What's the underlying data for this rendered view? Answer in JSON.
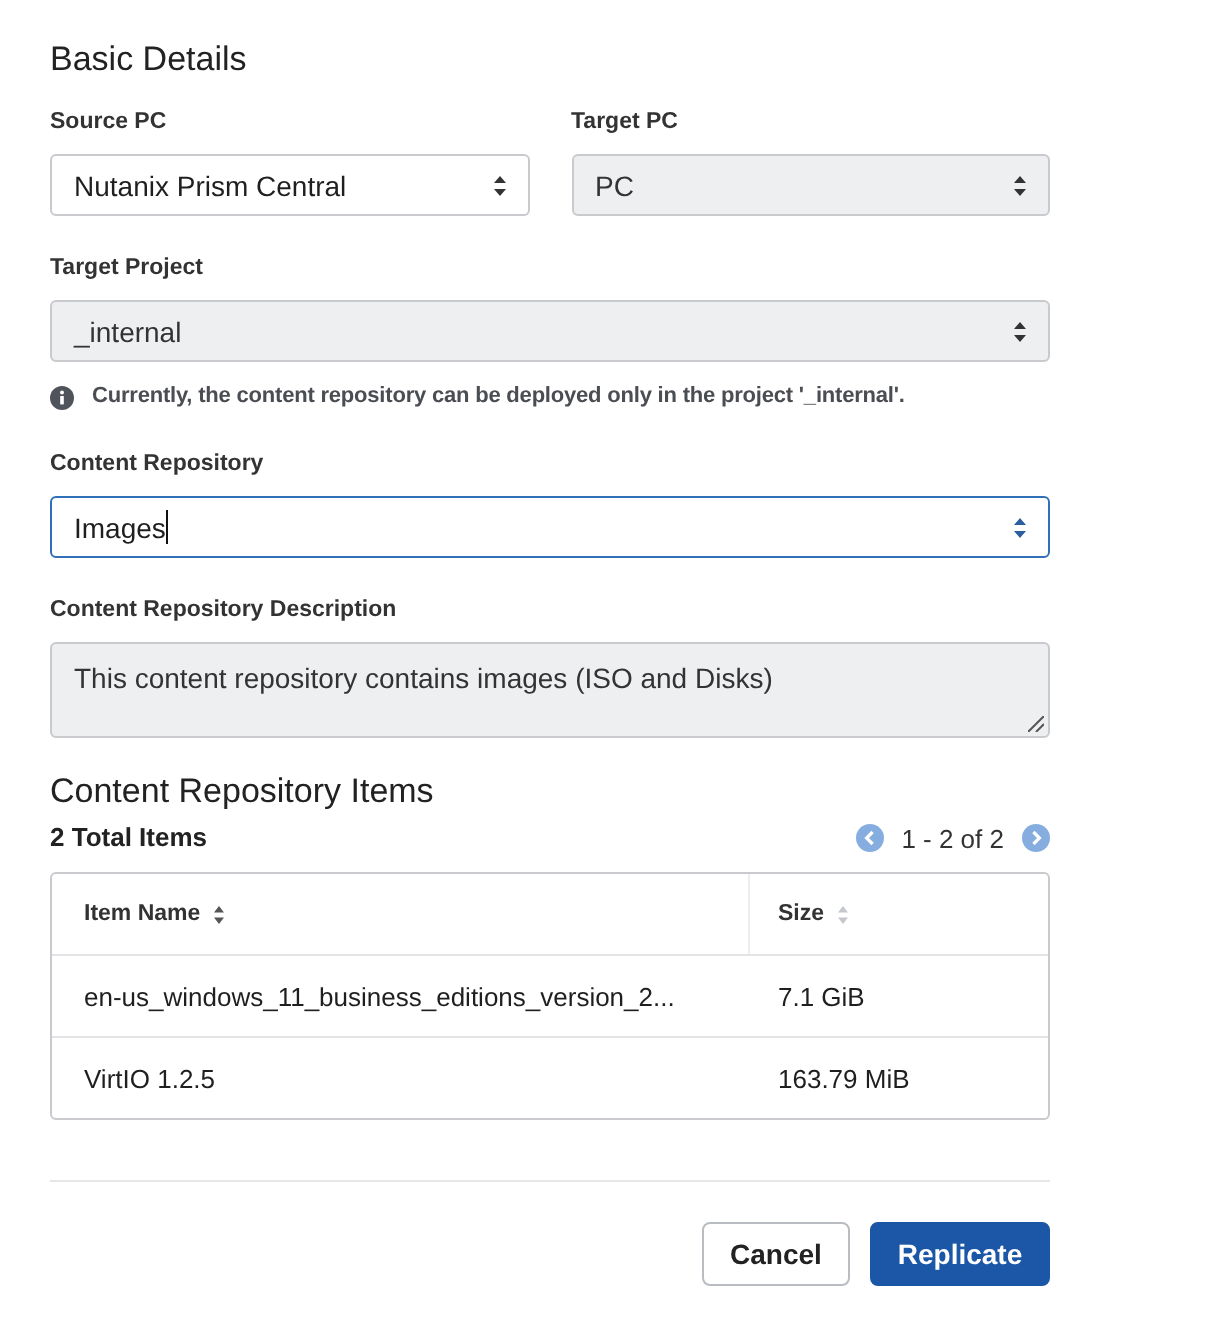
{
  "heading": "Basic Details",
  "source_pc": {
    "label": "Source PC",
    "value": "Nutanix Prism Central",
    "disabled": false,
    "focused": false
  },
  "target_pc": {
    "label": "Target PC",
    "value": "PC",
    "disabled": true,
    "focused": false
  },
  "target_project": {
    "label": "Target Project",
    "value": "_internal",
    "disabled": true,
    "focused": false,
    "note": "Currently, the content repository can be deployed only in the project '_internal'."
  },
  "content_repository": {
    "label": "Content Repository",
    "value": "Images",
    "disabled": false,
    "focused": true
  },
  "description": {
    "label": "Content Repository Description",
    "value": "This content repository contains images (ISO and Disks)",
    "disabled": true
  },
  "items": {
    "heading": "Content Repository Items",
    "total": "2 Total Items",
    "range": "1 - 2 of 2",
    "columns": [
      {
        "label": "Item Name",
        "sorted": true
      },
      {
        "label": "Size",
        "sorted": false
      }
    ],
    "rows": [
      {
        "item_name": "en-us_windows_11_business_editions_version_2...",
        "size": "7.1 GiB"
      },
      {
        "item_name": "VirtIO 1.2.5",
        "size": "163.79 MiB"
      }
    ]
  },
  "buttons": [
    {
      "label": "Cancel",
      "kind": "secondary"
    },
    {
      "label": "Replicate",
      "kind": "primary"
    }
  ]
}
